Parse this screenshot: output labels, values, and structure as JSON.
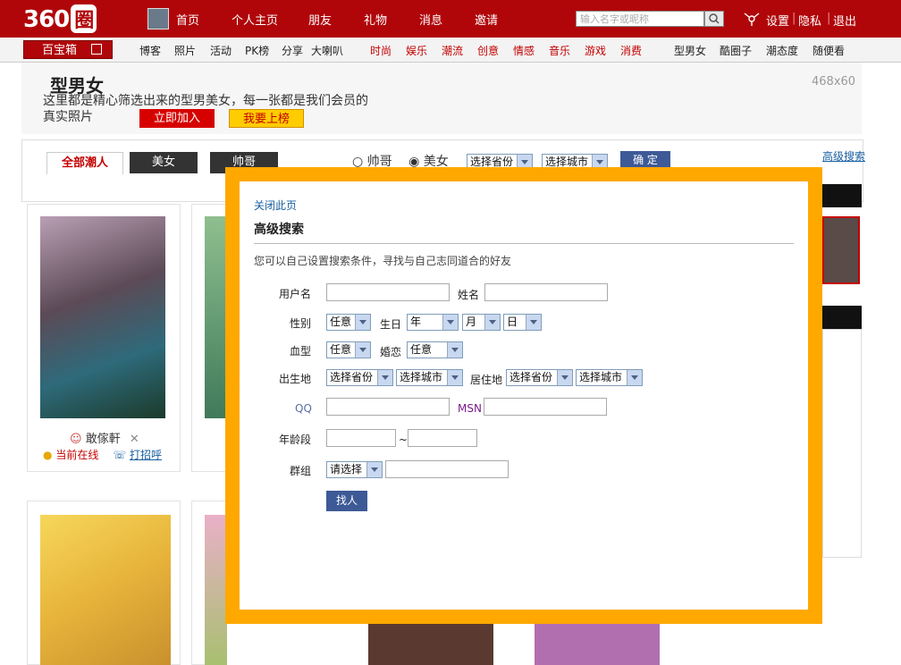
{
  "top": {
    "logo": "360圈",
    "nav": [
      "首页",
      "个人主页",
      "朋友",
      "礼物",
      "消息",
      "邀请"
    ],
    "search_placeholder": "输入名字或昵称",
    "links": [
      "设置",
      "隐私",
      "退出"
    ]
  },
  "nav2": {
    "treasure": "百宝箱",
    "items": [
      "博客",
      "照片",
      "活动",
      "PK榜",
      "分享",
      "大喇叭"
    ],
    "red_items": [
      "时尚",
      "娱乐",
      "潮流",
      "创意",
      "情感",
      "音乐",
      "游戏",
      "消费"
    ],
    "right_items": [
      "型男女",
      "酷圈子",
      "潮态度",
      "随便看"
    ]
  },
  "page": {
    "title": "型男女",
    "description": "这里都是精心筛选出来的型男美女，每一张都是我们会员的真实照片",
    "join": "立即加入",
    "rank": "我要上榜",
    "ad": "468x60",
    "tabs": [
      "全部潮人",
      "美女",
      "帅哥"
    ],
    "filter_options": [
      "帅哥",
      "美女"
    ],
    "filter_province": "选择省份",
    "filter_city": "选择城市",
    "filter_ok": "确 定",
    "advanced": "高级搜索",
    "card": {
      "name": "敢傢軒",
      "online": "当前在线",
      "greet": "打招呼"
    }
  },
  "modal": {
    "close": "关闭此页",
    "title": "高级搜索",
    "subtitle": "您可以自己设置搜索条件，寻找与自己志同道合的好友",
    "labels": {
      "username": "用户名",
      "name": "姓名",
      "gender": "性别",
      "birthday": "生日",
      "blood": "血型",
      "marriage": "婚恋",
      "birthplace": "出生地",
      "residence": "居住地",
      "qq": "QQ",
      "msn": "MSN",
      "age": "年龄段",
      "group": "群组"
    },
    "selects": {
      "gender": "任意",
      "year": "年",
      "month": "月",
      "day": "日",
      "blood": "任意",
      "marriage": "任意",
      "birth_province": "选择省份",
      "birth_city": "选择城市",
      "res_province": "选择省份",
      "res_city": "选择城市",
      "group": "请选择"
    },
    "age_sep": "~",
    "submit": "找人"
  },
  "colors": {
    "brand": "#b0060a",
    "frame": "#ffa800",
    "button": "#3d5a97"
  }
}
